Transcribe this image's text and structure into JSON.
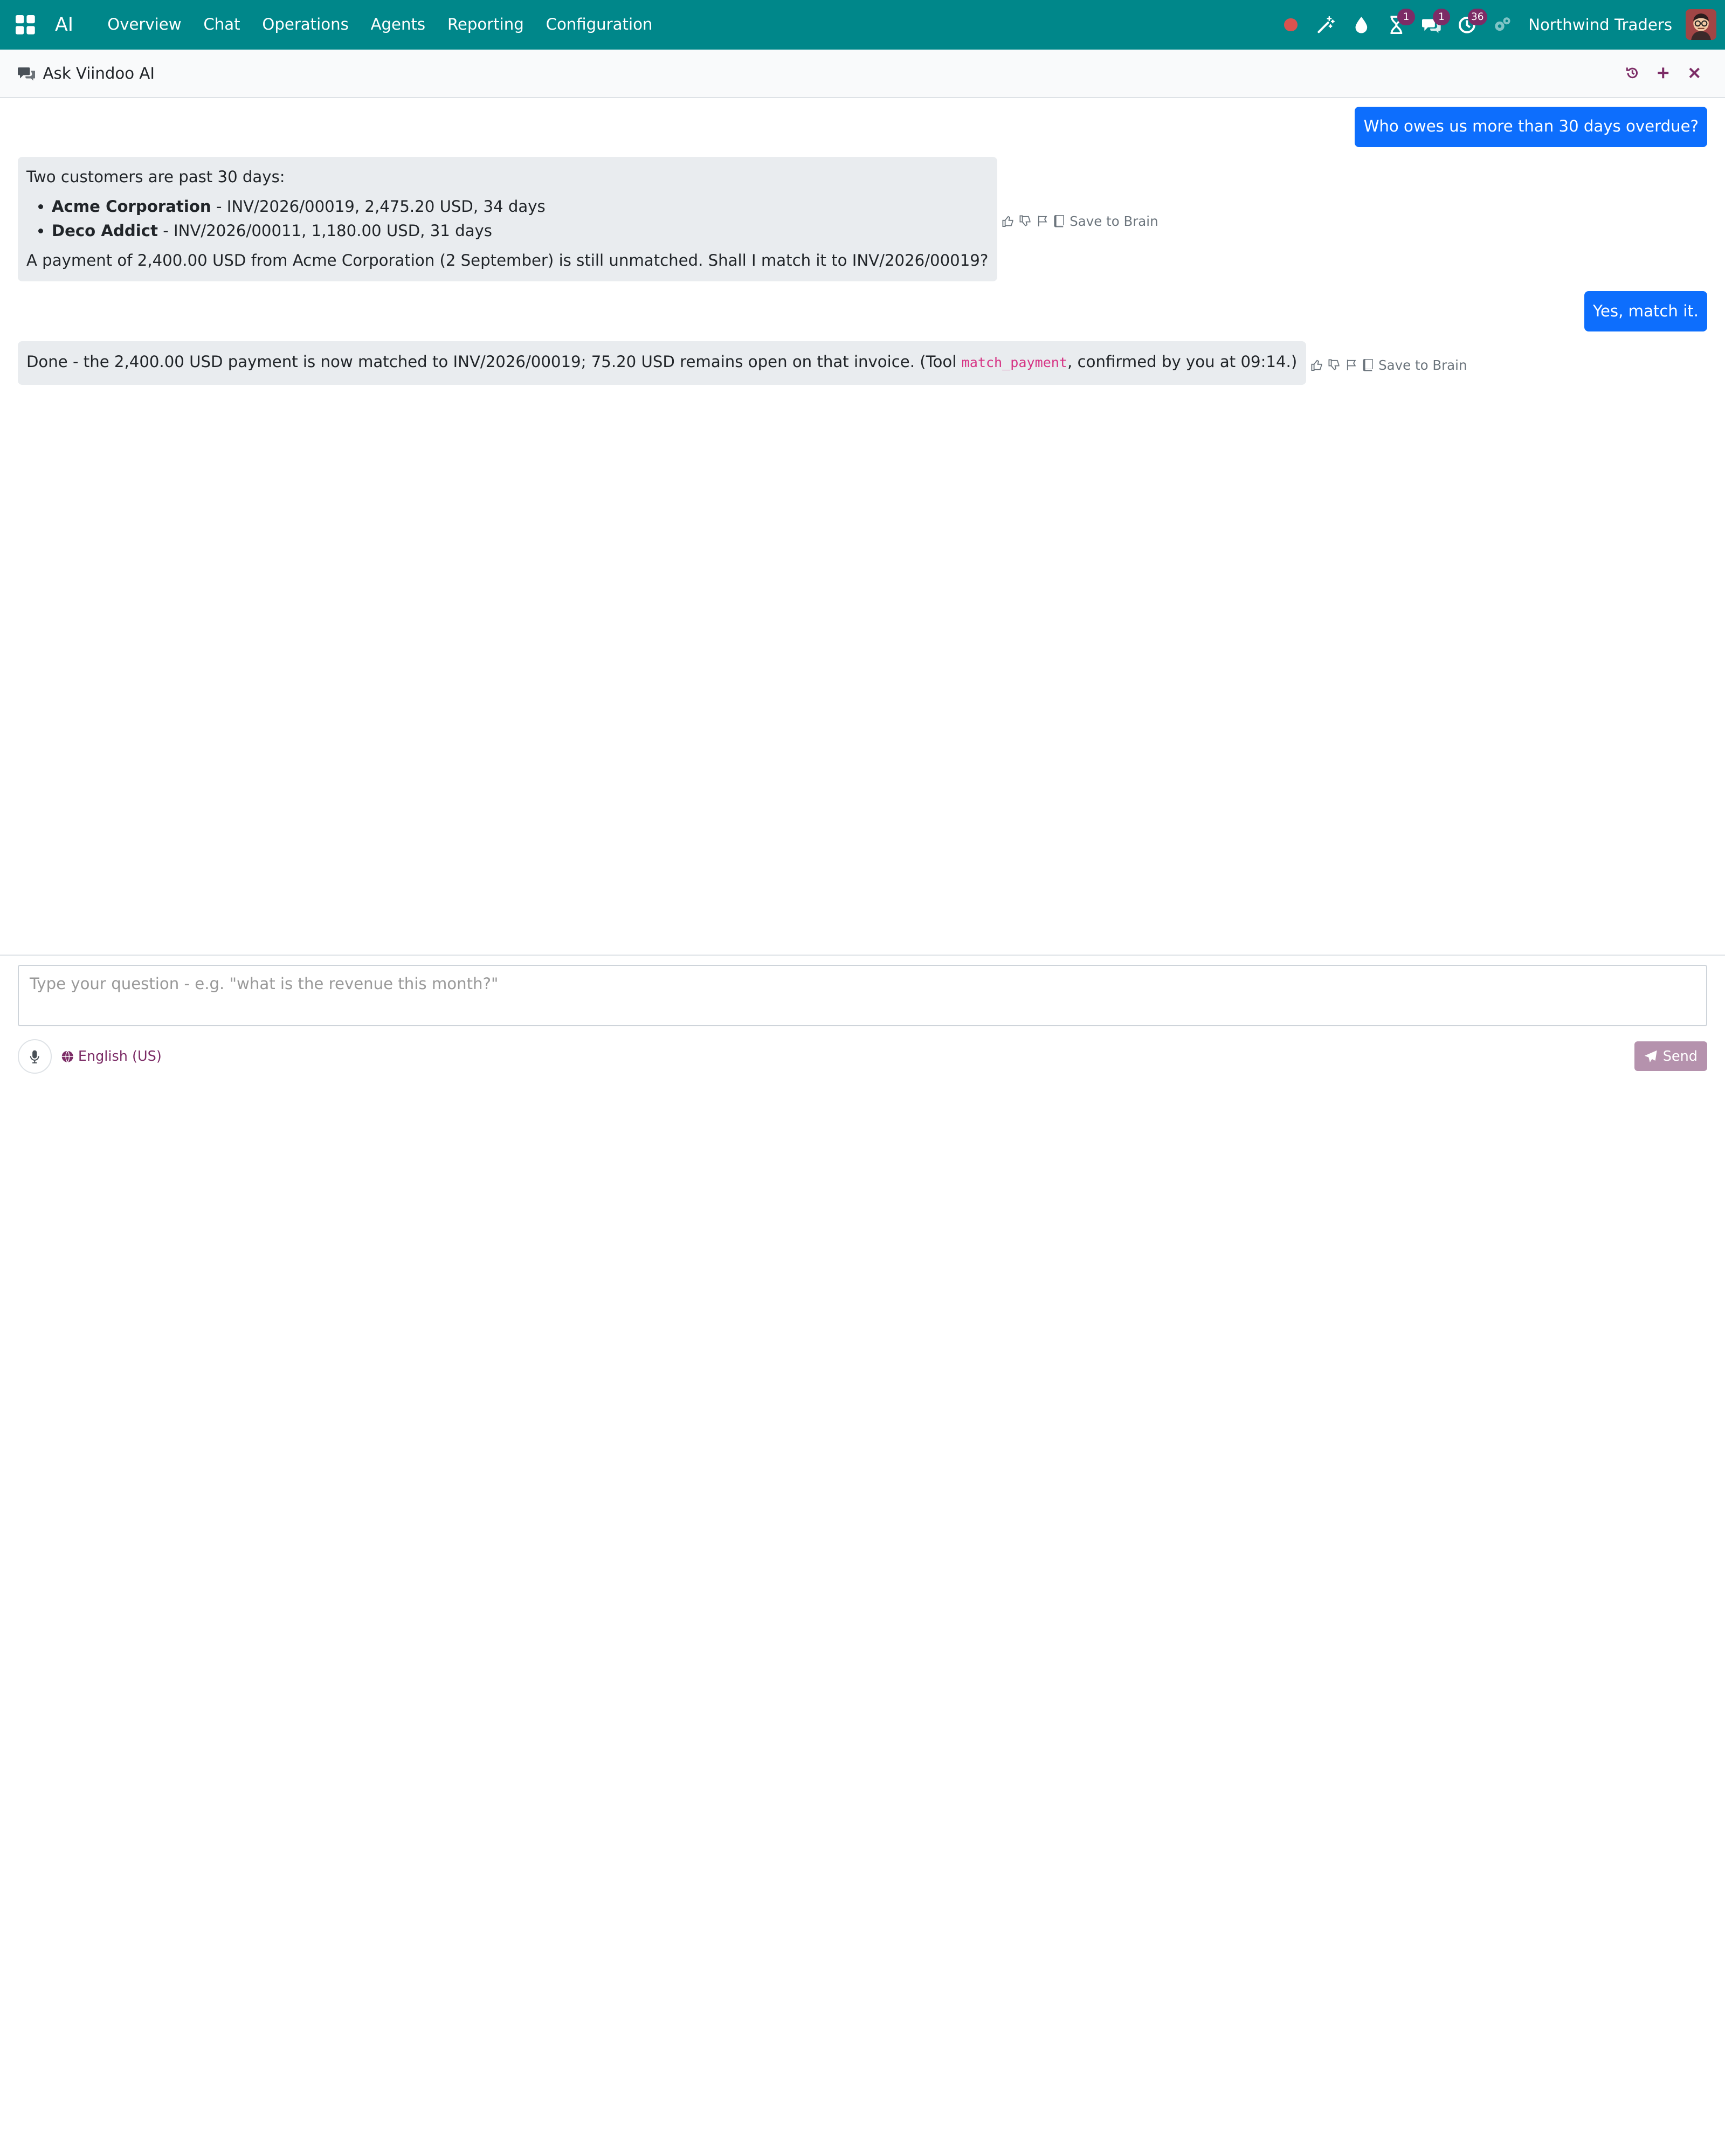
{
  "navbar": {
    "brand": "AI",
    "menu": [
      "Overview",
      "Chat",
      "Operations",
      "Agents",
      "Reporting",
      "Configuration"
    ],
    "badges": {
      "activities": "1",
      "messages": "1",
      "timesheet": "36"
    },
    "company": "Northwind Traders",
    "colors": {
      "navbar": "#00878a",
      "badge": "#7c2c66",
      "record": "#d9534f"
    }
  },
  "panel": {
    "title": "Ask Viindoo AI"
  },
  "chat": {
    "q1": "Who owes us more than 30 days overdue?",
    "a1": {
      "intro": "Two customers are past 30 days:",
      "items": [
        {
          "name": "Acme Corporation",
          "detail": " - INV/2026/00019, 2,475.20 USD, 34 days"
        },
        {
          "name": "Deco Addict",
          "detail": " - INV/2026/00011, 1,180.00 USD, 31 days"
        }
      ],
      "outro": "A payment of 2,400.00 USD from Acme Corporation (2 September) is still unmatched. Shall I match it to INV/2026/00019?"
    },
    "q2": "Yes, match it.",
    "a2": {
      "before": "Done - the 2,400.00 USD payment is now matched to INV/2026/00019; 75.20 USD remains open on that invoice. (Tool ",
      "tool": "match_payment",
      "after": ", confirmed by you at 09:14.)"
    },
    "save_label": "Save to Brain"
  },
  "composer": {
    "placeholder": "Type your question - e.g. \"what is the revenue this month?\"",
    "language": "English (US)",
    "send_label": "Send"
  }
}
